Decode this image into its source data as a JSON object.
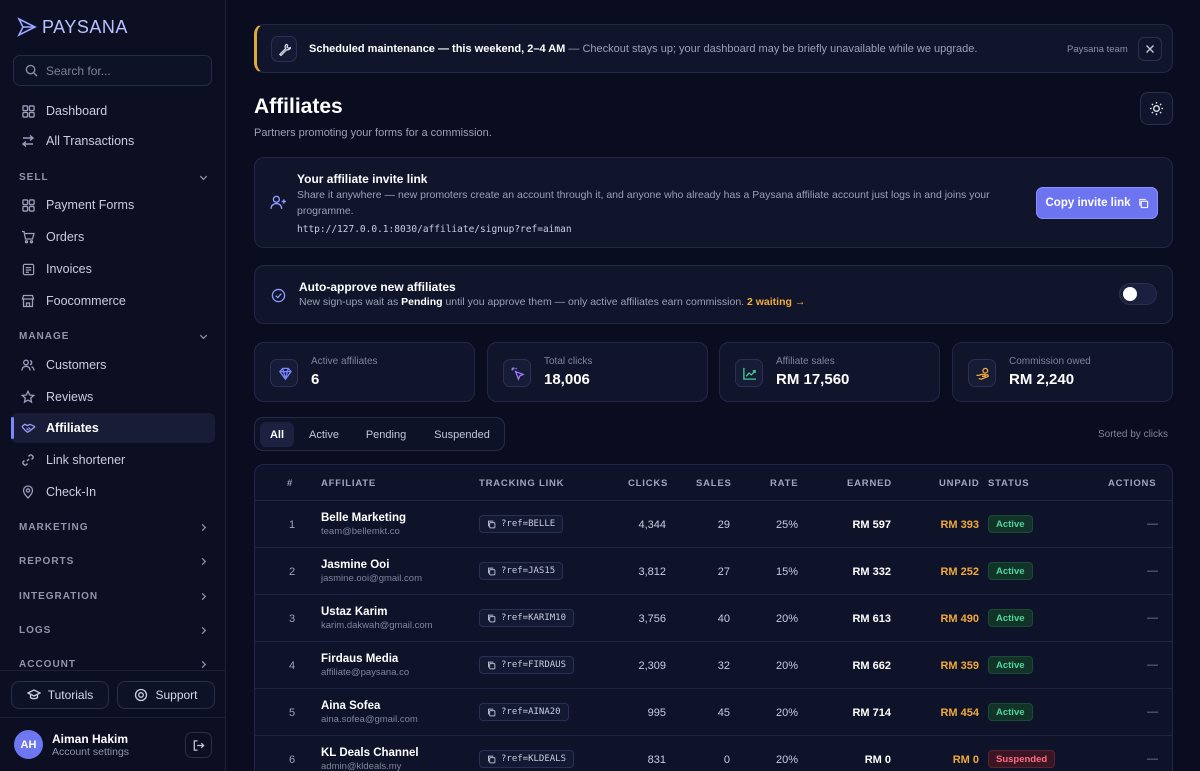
{
  "brand": {
    "name": "PAYSANA"
  },
  "search": {
    "placeholder": "Search for..."
  },
  "nav": {
    "dashboard": "Dashboard",
    "all_transactions": "All Transactions",
    "sell_label": "SELL",
    "payment_forms": "Payment Forms",
    "orders": "Orders",
    "invoices": "Invoices",
    "foocommerce": "Foocommerce",
    "manage_label": "MANAGE",
    "customers": "Customers",
    "reviews": "Reviews",
    "affiliates": "Affiliates",
    "link_shortener": "Link shortener",
    "check_in": "Check-In",
    "marketing_label": "MARKETING",
    "reports_label": "REPORTS",
    "integration_label": "INTEGRATION",
    "logs_label": "LOGS",
    "account_label": "ACCOUNT"
  },
  "sidebar_buttons": {
    "tutorials": "Tutorials",
    "support": "Support"
  },
  "user": {
    "initials": "AH",
    "name": "Aiman Hakim",
    "subtitle": "Account settings"
  },
  "banner": {
    "title": "Scheduled maintenance — this weekend, 2–4 AM",
    "message": " — Checkout stays up; your dashboard may be briefly unavailable while we upgrade.",
    "team": "Paysana team",
    "accent": "#e0a83a"
  },
  "page": {
    "title": "Affiliates",
    "subtitle": "Partners promoting your forms for a commission."
  },
  "invite": {
    "title": "Your affiliate invite link",
    "description": "Share it anywhere — new promoters create an account through it, and anyone who already has a Paysana affiliate account just logs in and joins your programme.",
    "link": "http://127.0.0.1:8030/affiliate/signup?ref=aiman",
    "button": "Copy invite link"
  },
  "auto_approve": {
    "title": "Auto-approve new affiliates",
    "desc_prefix": "New sign-ups wait as ",
    "desc_strong": "Pending",
    "desc_suffix": " until you approve them — only active affiliates earn commission. ",
    "waiting": "2 waiting →",
    "enabled": false
  },
  "stats": [
    {
      "label": "Active affiliates",
      "value": "6",
      "icon": "diamond-icon",
      "color": "#7b86ff"
    },
    {
      "label": "Total clicks",
      "value": "18,006",
      "icon": "cursor-click-icon",
      "color": "#9a7bff"
    },
    {
      "label": "Affiliate sales",
      "value": "RM 17,560",
      "icon": "trend-up-icon",
      "color": "#3fcf8e"
    },
    {
      "label": "Commission owed",
      "value": "RM 2,240",
      "icon": "hand-coins-icon",
      "color": "#f0a93a"
    }
  ],
  "filters": {
    "all": "All",
    "active": "Active",
    "pending": "Pending",
    "suspended": "Suspended"
  },
  "sorted_note": "Sorted by clicks",
  "table": {
    "headers": {
      "num": "#",
      "affiliate": "AFFILIATE",
      "tracking": "TRACKING LINK",
      "clicks": "CLICKS",
      "sales": "SALES",
      "rate": "RATE",
      "earned": "EARNED",
      "unpaid": "UNPAID",
      "status": "STATUS",
      "actions": "ACTIONS"
    },
    "rows": [
      {
        "num": "1",
        "name": "Belle Marketing",
        "email": "team@bellemkt.co",
        "ref": "?ref=BELLE",
        "clicks": "4,344",
        "sales": "29",
        "rate": "25%",
        "earned": "RM 597",
        "unpaid": "RM 393",
        "status": "Active",
        "actions": "—"
      },
      {
        "num": "2",
        "name": "Jasmine Ooi",
        "email": "jasmine.ooi@gmail.com",
        "ref": "?ref=JAS15",
        "clicks": "3,812",
        "sales": "27",
        "rate": "15%",
        "earned": "RM 332",
        "unpaid": "RM 252",
        "status": "Active",
        "actions": "—"
      },
      {
        "num": "3",
        "name": "Ustaz Karim",
        "email": "karim.dakwah@gmail.com",
        "ref": "?ref=KARIM10",
        "clicks": "3,756",
        "sales": "40",
        "rate": "20%",
        "earned": "RM 613",
        "unpaid": "RM 490",
        "status": "Active",
        "actions": "—"
      },
      {
        "num": "4",
        "name": "Firdaus Media",
        "email": "affiliate@paysana.co",
        "ref": "?ref=FIRDAUS",
        "clicks": "2,309",
        "sales": "32",
        "rate": "20%",
        "earned": "RM 662",
        "unpaid": "RM 359",
        "status": "Active",
        "actions": "—"
      },
      {
        "num": "5",
        "name": "Aina Sofea",
        "email": "aina.sofea@gmail.com",
        "ref": "?ref=AINA20",
        "clicks": "995",
        "sales": "45",
        "rate": "20%",
        "earned": "RM 714",
        "unpaid": "RM 454",
        "status": "Active",
        "actions": "—"
      },
      {
        "num": "6",
        "name": "KL Deals Channel",
        "email": "admin@kldeals.my",
        "ref": "?ref=KLDEALS",
        "clicks": "831",
        "sales": "0",
        "rate": "20%",
        "earned": "RM 0",
        "unpaid": "RM 0",
        "status": "Suspended",
        "actions": "—"
      }
    ]
  }
}
